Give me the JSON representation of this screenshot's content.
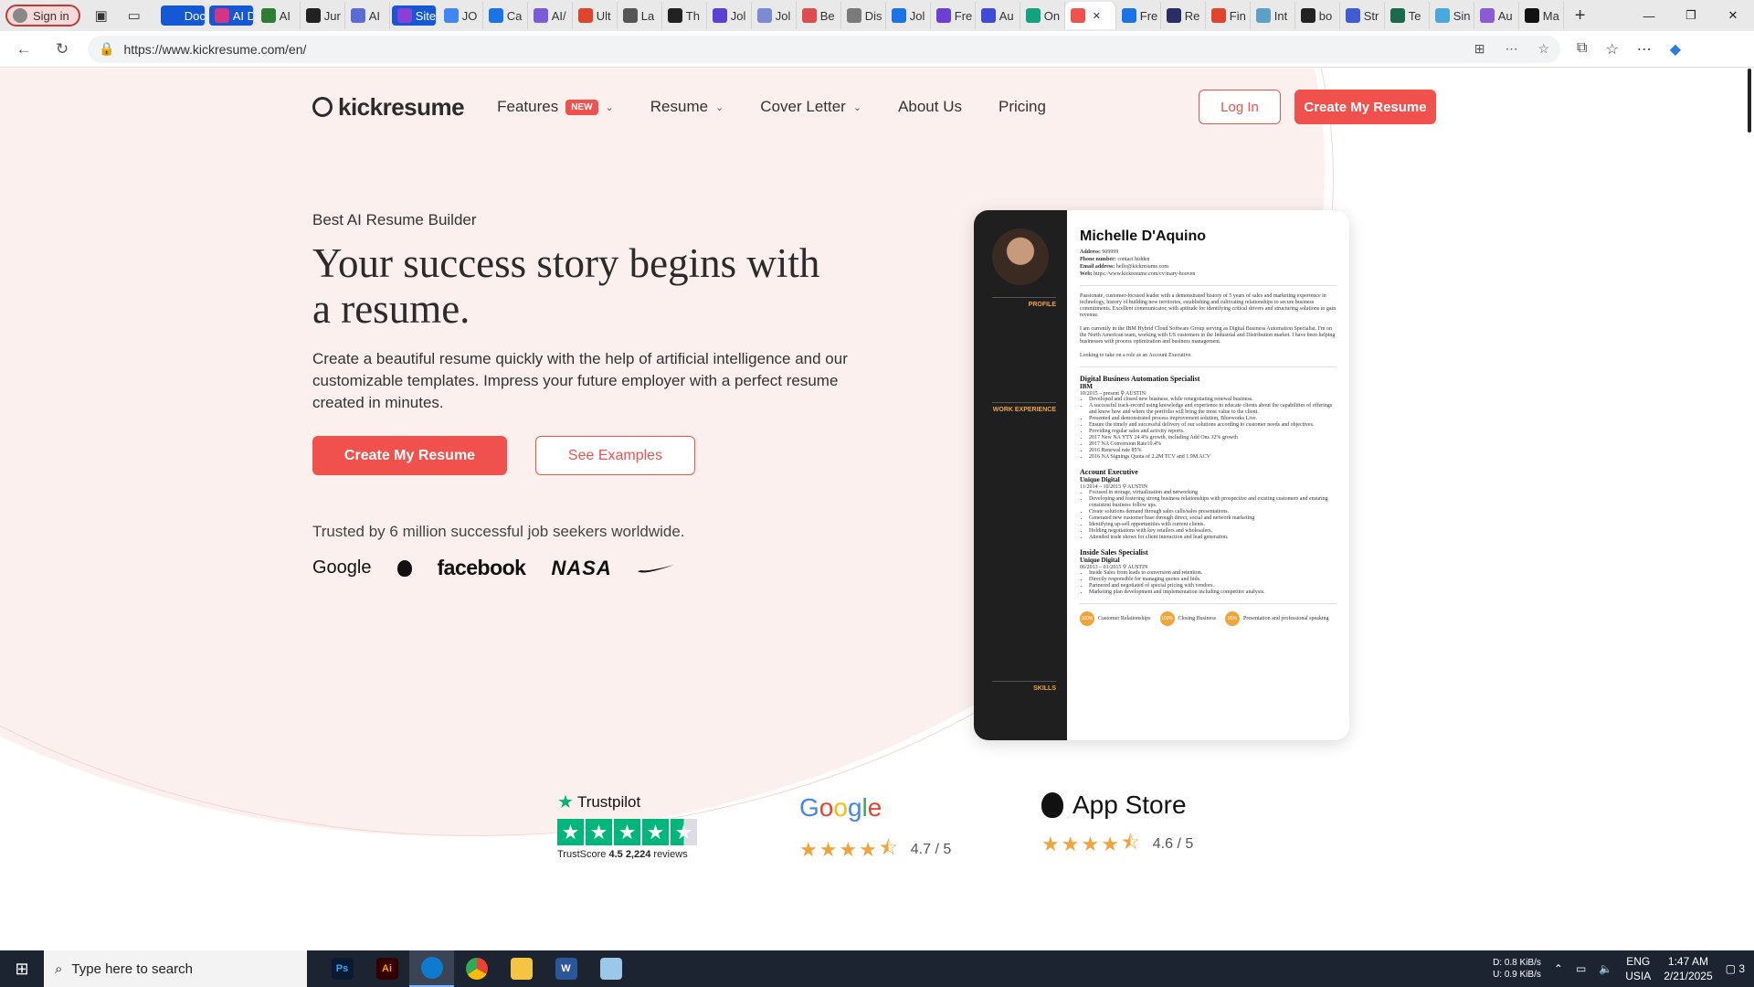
{
  "browser": {
    "signin_label": "Sign in",
    "tabs": [
      {
        "label": "Doc",
        "color": "#1558d6",
        "group": true
      },
      {
        "label": "AI D",
        "color": "#d63384",
        "group": true
      },
      {
        "label": "AI",
        "color": "#2e7d32"
      },
      {
        "label": "Jur",
        "color": "#222222"
      },
      {
        "label": "AI",
        "color": "#5b6bd6"
      },
      {
        "label": "Site",
        "color": "#8b3fd6",
        "group": true
      },
      {
        "label": "JO",
        "color": "#4285f4"
      },
      {
        "label": "Ca",
        "color": "#1a73e8"
      },
      {
        "label": "AI/",
        "color": "#7b5bd6"
      },
      {
        "label": "Ult",
        "color": "#e0452b"
      },
      {
        "label": "La",
        "color": "#555555"
      },
      {
        "label": "Th",
        "color": "#222222"
      },
      {
        "label": "Jol",
        "color": "#5b3fd6"
      },
      {
        "label": "Jol",
        "color": "#7a8ad6"
      },
      {
        "label": "Be",
        "color": "#e04b4b"
      },
      {
        "label": "Dis",
        "color": "#7a7a7a"
      },
      {
        "label": "Jol",
        "color": "#1a73e8"
      },
      {
        "label": "Fre",
        "color": "#6b3fd6"
      },
      {
        "label": "Au",
        "color": "#3f4bd6"
      },
      {
        "label": "On",
        "color": "#10a37f"
      },
      {
        "label": "",
        "color": "#f0514d",
        "active": true
      },
      {
        "label": "Fre",
        "color": "#1a73e8"
      },
      {
        "label": "Re",
        "color": "#2c2c6b"
      },
      {
        "label": "Fin",
        "color": "#e0452b"
      },
      {
        "label": "Int",
        "color": "#5aa0c8"
      },
      {
        "label": "bo",
        "color": "#222222"
      },
      {
        "label": "Str",
        "color": "#3f5bd6"
      },
      {
        "label": "Te",
        "color": "#1a6b4b"
      },
      {
        "label": "Sin",
        "color": "#4aa8e0"
      },
      {
        "label": "Au",
        "color": "#8b5bd6"
      },
      {
        "label": "Ma",
        "color": "#111111"
      }
    ],
    "url": "https://www.kickresume.com/en/"
  },
  "site": {
    "logo": "kickresume",
    "nav": [
      {
        "label": "Features",
        "badge": "NEW",
        "dropdown": true
      },
      {
        "label": "Resume",
        "dropdown": true
      },
      {
        "label": "Cover Letter",
        "dropdown": true
      },
      {
        "label": "About Us"
      },
      {
        "label": "Pricing"
      }
    ],
    "login_label": "Log In",
    "create_label": "Create My Resume"
  },
  "hero": {
    "kicker": "Best AI Resume Builder",
    "title": "Your success story begins with a resume.",
    "lead": "Create a beautiful resume quickly with the help of artificial intelligence and our customizable templates. Impress your future employer with a perfect resume created in minutes.",
    "primary_cta": "Create My Resume",
    "secondary_cta": "See Examples",
    "trusted": "Trusted by 6 million successful job seekers worldwide.",
    "brands": {
      "google": "Google",
      "facebook": "facebook",
      "nasa": "NASA"
    }
  },
  "resume": {
    "name": "Michelle D'Aquino",
    "address_label": "Address:",
    "address": "909999",
    "phone_label": "Phone number:",
    "phone": "contact hidden",
    "email_label": "Email address:",
    "email": "hello@kickresume.com",
    "web_label": "Web:",
    "web": "https://www.kickresume.com/cv/mary-hooven",
    "sections": {
      "profile": "PROFILE",
      "work": "WORK EXPERIENCE",
      "skills": "SKILLS"
    },
    "profile_p1": "Passionate, customer-focused leader with a demonstrated history of 5 years of sales and marketing experience in technology, history of building new territories, establishing and cultivating relationships to secure business commitments. Excellent communicator, with aptitude for identifying critical drivers and structuring solutions to gain revenue.",
    "profile_p2": "I am currently in the IBM Hybrid Cloud Software Group serving as Digital Business Automation Specialist. I'm on the North American team, working with US customers in the Industrial and Distribution market. I have been helping businesses with process optimization and business management.",
    "profile_p3": "Looking to take on a role as an Account Executive.",
    "jobs": [
      {
        "title": "Digital Business Automation Specialist",
        "company": "IBM",
        "meta": "10/2015 – present  ⚲ AUSTIN",
        "bullets": [
          "Developed and closed new business, while renegotiating renewal business.",
          "A successful track-record using knowledge and experience to educate clients about the capabilities of offerings and know how and where the portfolio will bring the most value to the client.",
          "Presented and demonstrated process improvement solution, Blueworks Live.",
          "Ensure the timely and successful delivery of our solutions according to customer needs and objectives.",
          "Providing regular sales and activity reports.",
          "2017 New NA YTY 24.4% growth, including Add Ons 32% growth",
          "2017 NA Conversion Rate10.4%",
          "2016 Renewal rate 85%",
          "2016 NA Signings Quota of 2.2M TCV and 1.9M ACV"
        ]
      },
      {
        "title": "Account Executive",
        "company": "Unique Digital",
        "meta": "11/2014 – 10/2015  ⚲ AUSTIN",
        "bullets": [
          "Focused in storage, virtualization and networking",
          "Developing and fostering strong business relationships with prospective and existing customers and ensuring consistent business follow ups.",
          "Create solutions demand through sales calls/sales presentations.",
          "Generated new customer base through direct, social and network marketing",
          "Identifying up-sell opportunities with current clients.",
          "Holding negotiations with key retailers and wholesalers.",
          "Attended trade shows for client interaction and lead generation."
        ]
      },
      {
        "title": "Inside Sales Specialist",
        "company": "Unique Digital",
        "meta": "06/2013 – 01/2015  ⚲ AUSTIN",
        "bullets": [
          "Inside Sales from leads to conversion and retention.",
          "Directly responsible for managing quotes and bids.",
          "Partnered and negotiated of special pricing with vendors.",
          "Marketing plan development and implementation including competitor analysis."
        ]
      }
    ],
    "skills": [
      {
        "value": "100%",
        "label": "Customer Relationships"
      },
      {
        "value": "100%",
        "label": "Closing Business"
      },
      {
        "value": "95%",
        "label": "Presentation and professional speaking"
      }
    ]
  },
  "ratings": {
    "trustpilot": {
      "name": "Trustpilot",
      "score_prefix": "TrustScore",
      "score": "4.5",
      "reviews": "2,224",
      "reviews_suffix": "reviews"
    },
    "google": {
      "name": "Google",
      "score": "4.7 / 5"
    },
    "appstore": {
      "name": "App Store",
      "score": "4.6 / 5"
    }
  },
  "taskbar": {
    "search_placeholder": "Type here to search",
    "net_down_label": "D:",
    "net_down": "0.8 KiB/s",
    "net_up_label": "U:",
    "net_up": "0.9 KiB/s",
    "lang": "ENG",
    "region": "USIA",
    "time": "1:47 AM",
    "date": "2/21/2025",
    "notifications": "3"
  }
}
